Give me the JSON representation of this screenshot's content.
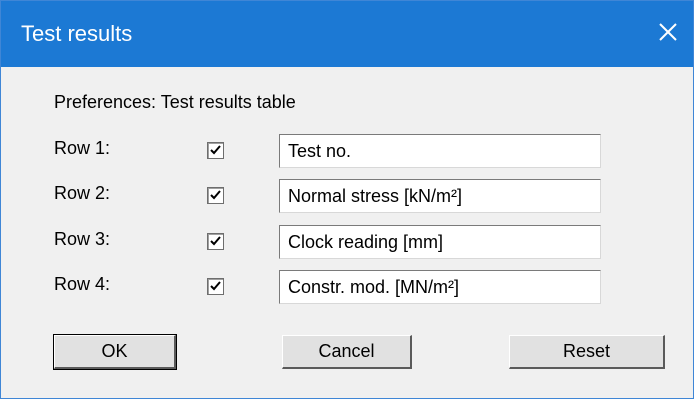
{
  "window": {
    "title": "Test results",
    "close_icon": "close-icon"
  },
  "caption": "Preferences: Test results table",
  "rows": [
    {
      "label": "Row 1:",
      "checked": true,
      "value": "Test no."
    },
    {
      "label": "Row 2:",
      "checked": true,
      "value": "Normal stress [kN/m²]"
    },
    {
      "label": "Row 3:",
      "checked": true,
      "value": "Clock reading [mm]"
    },
    {
      "label": "Row 4:",
      "checked": true,
      "value": "Constr. mod. [MN/m²]"
    }
  ],
  "buttons": {
    "ok": "OK",
    "cancel": "Cancel",
    "reset": "Reset"
  },
  "colors": {
    "titlebar": "#1c79d4",
    "dialog_bg": "#f0f0f0"
  }
}
